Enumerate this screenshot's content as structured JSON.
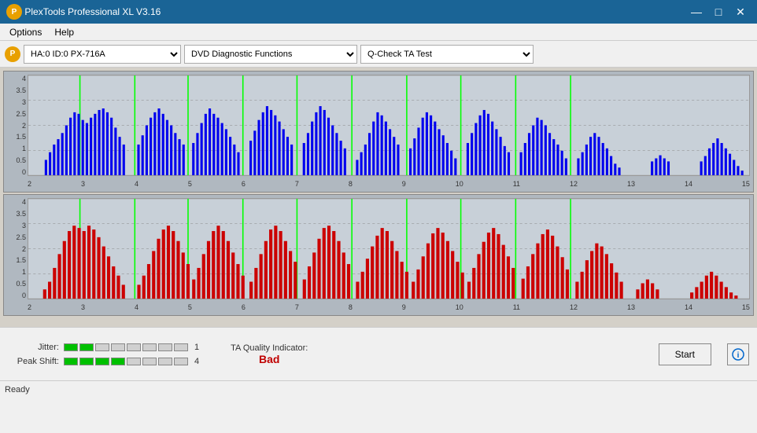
{
  "titleBar": {
    "title": "PlexTools Professional XL V3.16",
    "minimizeLabel": "—",
    "maximizeLabel": "□",
    "closeLabel": "✕"
  },
  "menuBar": {
    "items": [
      "Options",
      "Help"
    ]
  },
  "toolbar": {
    "driveIcon": "P",
    "driveValue": "HA:0 ID:0  PX-716A",
    "functionValue": "DVD Diagnostic Functions",
    "testValue": "Q-Check TA Test"
  },
  "topChart": {
    "yLabels": [
      "4",
      "3.5",
      "3",
      "2.5",
      "2",
      "1.5",
      "1",
      "0.5",
      "0"
    ],
    "xLabels": [
      "2",
      "3",
      "4",
      "5",
      "6",
      "7",
      "8",
      "9",
      "10",
      "11",
      "12",
      "13",
      "14",
      "15"
    ]
  },
  "bottomChart": {
    "yLabels": [
      "4",
      "3.5",
      "3",
      "2.5",
      "2",
      "1.5",
      "1",
      "0.5",
      "0"
    ],
    "xLabels": [
      "2",
      "3",
      "4",
      "5",
      "6",
      "7",
      "8",
      "9",
      "10",
      "11",
      "12",
      "13",
      "14",
      "15"
    ]
  },
  "metrics": {
    "jitterLabel": "Jitter:",
    "jitterValue": "1",
    "jitterGreenCount": 2,
    "jitterTotalCount": 8,
    "peakShiftLabel": "Peak Shift:",
    "peakShiftValue": "4",
    "peakShiftGreenCount": 4,
    "peakShiftTotalCount": 8,
    "taQualityLabel": "TA Quality Indicator:",
    "taQualityValue": "Bad"
  },
  "buttons": {
    "start": "Start",
    "info": "ⓘ"
  },
  "statusBar": {
    "text": "Ready"
  },
  "greenLinePositions": [
    0.072,
    0.148,
    0.222,
    0.296,
    0.37,
    0.444,
    0.518,
    0.592,
    0.666,
    0.74
  ]
}
